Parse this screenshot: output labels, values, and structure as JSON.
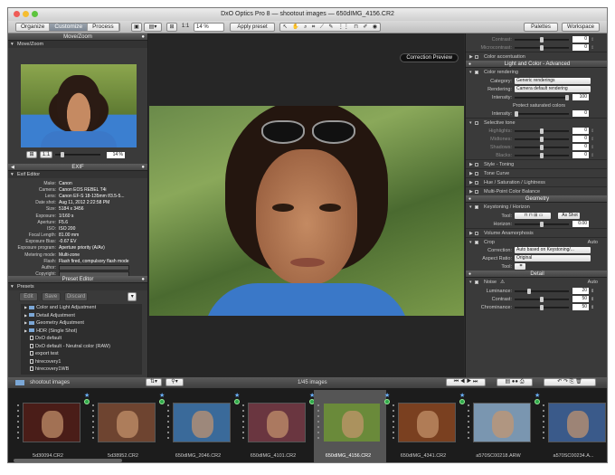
{
  "window": {
    "title": "DxO Optics Pro 8 — shootout images — 650dIMG_4156.CR2"
  },
  "toolbar": {
    "tabs": [
      "Organize",
      "Customize",
      "Process"
    ],
    "zoom_value": "1:1",
    "zoom_percent": "14 %",
    "apply_preset": "Apply preset",
    "palettes": "Palettes",
    "workspace": "Workspace"
  },
  "left": {
    "movezoom": {
      "title": "Move/Zoom",
      "sub": "Move/Zoom",
      "scale": "1:1",
      "percent": "14 %"
    },
    "exif": {
      "title": "EXIF",
      "sub": "Exif Editor",
      "rows": [
        {
          "k": "Make:",
          "v": "Canon"
        },
        {
          "k": "Camera:",
          "v": "Canon EOS REBEL T4i"
        },
        {
          "k": "Lens:",
          "v": "Canon EF-S 18-135mm f/3.5-5..."
        },
        {
          "k": "Date shot:",
          "v": "Aug 11, 2012 2:22:58 PM"
        },
        {
          "k": "Size:",
          "v": "5184 x 3456"
        },
        {
          "k": "Exposure:",
          "v": "1/160 s"
        },
        {
          "k": "Aperture:",
          "v": "F5.6"
        },
        {
          "k": "ISO:",
          "v": "ISO 200"
        },
        {
          "k": "Focal Length:",
          "v": "81.00 mm"
        },
        {
          "k": "Exposure Bias:",
          "v": "-0.67 EV"
        },
        {
          "k": "Exposure program:",
          "v": "Aperture priority (A/Av)"
        },
        {
          "k": "Metering mode:",
          "v": "Multi-zone"
        },
        {
          "k": "Flash:",
          "v": "Flash fired, compulsory flash mode"
        },
        {
          "k": "Author:",
          "v": ""
        },
        {
          "k": "Copyright:",
          "v": ""
        }
      ]
    },
    "presets": {
      "title": "Preset Editor",
      "sub": "Presets",
      "edit": "Edit",
      "save": "Save",
      "discard": "Discard",
      "items": [
        {
          "label": "Color and Light Adjustment",
          "kind": "folder"
        },
        {
          "label": "Detail Adjustment",
          "kind": "folder"
        },
        {
          "label": "Geometry Adjustment",
          "kind": "folder"
        },
        {
          "label": "HDR (Single Shot)",
          "kind": "folder"
        },
        {
          "label": "DxO default",
          "kind": "doc"
        },
        {
          "label": "DxO default - Neutral color (RAW)",
          "kind": "doc"
        },
        {
          "label": "export test",
          "kind": "doc"
        },
        {
          "label": "hirecovery1",
          "kind": "doc"
        },
        {
          "label": "hirecovery1WB",
          "kind": "doc"
        }
      ]
    }
  },
  "center": {
    "correction_preview": "Correction Preview"
  },
  "right": {
    "top_rows": [
      {
        "label": "Contrast:",
        "value": "0"
      },
      {
        "label": "Microcontrast:",
        "value": "0"
      }
    ],
    "color_accentuation": "Color accentuation",
    "light_color_title": "Light and Color - Advanced",
    "color_rendering": {
      "title": "Color rendering",
      "category_label": "Category:",
      "category": "Generic renderings",
      "rendering_label": "Rendering:",
      "rendering": "Camera default rendering",
      "intensity_label": "Intensity:",
      "intensity": "100",
      "protect": "Protect saturated colors",
      "protect_intensity": "0"
    },
    "selective_tone": {
      "title": "Selective tone",
      "rows": [
        {
          "label": "Highlights:",
          "value": "0"
        },
        {
          "label": "Midtones:",
          "value": "0"
        },
        {
          "label": "Shadows:",
          "value": "0"
        },
        {
          "label": "Blacks:",
          "value": "0"
        }
      ]
    },
    "sections": [
      "Style - Toning",
      "Tone Curve",
      "Hue / Saturation / Lightness",
      "Multi-Point Color Balance"
    ],
    "geometry": {
      "title": "Geometry",
      "keystoning": "Keystoning / Horizon",
      "tool_label": "Tool:",
      "as_shot": "As Shot",
      "horizon_label": "Horizon:",
      "horizon": "0.00",
      "volume": "Volume Anamorphosis",
      "crop": {
        "title": "Crop",
        "auto": "Auto",
        "correction_label": "Correction:",
        "correction": "Auto based on Keystoning/...",
        "aspect_label": "Aspect Ratio:",
        "aspect": "Original",
        "tool_label": "Tool:"
      }
    },
    "detail": {
      "title": "Detail",
      "noise": "Noise",
      "auto": "Auto",
      "rows": [
        {
          "label": "Luminance:",
          "value": "20"
        },
        {
          "label": "Contrast:",
          "value": "50"
        },
        {
          "label": "Chrominance:",
          "value": "50"
        }
      ]
    }
  },
  "strip": {
    "folder": "shootout images",
    "count": "1/45 images",
    "thumbs": [
      {
        "name": "5d30094.CR2",
        "bg": "#4a1d18"
      },
      {
        "name": "5d38952.CR2",
        "bg": "#6e4430"
      },
      {
        "name": "650dIMG_2046.CR2",
        "bg": "#3a6a9a"
      },
      {
        "name": "650dIMG_4101.CR2",
        "bg": "#6a3640"
      },
      {
        "name": "650dIMG_4156.CR2",
        "bg": "#6a8a3a"
      },
      {
        "name": "650dIMG_4341.CR2",
        "bg": "#7a4020"
      },
      {
        "name": "a570SC00218.ARW",
        "bg": "#7a96b0"
      },
      {
        "name": "a570SC00234.A...",
        "bg": "#3a5a8a"
      }
    ]
  }
}
